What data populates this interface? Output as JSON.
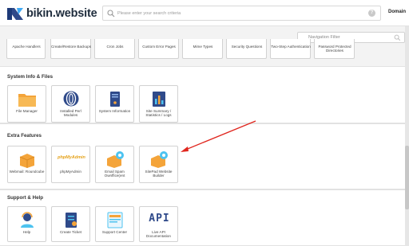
{
  "header": {
    "brand": "bikin.website",
    "search_placeholder": "Please enter your search criteria",
    "help_icon": "?",
    "domain_link": "Domain"
  },
  "nav_filter": {
    "placeholder": "Navigation Filter"
  },
  "strip": {
    "items": [
      "Apache Handlers",
      "Create/Restore Backups",
      "Cron Jobs",
      "Custom Error Pages",
      "Mime Types",
      "Security Questions",
      "Two-Step Authentication",
      "Password Protected Directories"
    ]
  },
  "sections": {
    "system_info": {
      "title": "System Info & Files",
      "tiles": [
        "File Manager",
        "Installed Perl Modules",
        "System Information",
        "Site Summary / Statistics / Logs"
      ]
    },
    "extra_features": {
      "title": "Extra Features",
      "tiles": [
        "Webmail: Roundcube",
        "phpMyAdmin",
        "Email Spam Ownffice(ent",
        "SitePad Website Builder"
      ],
      "phpmyadmin_logo": "phpMyAdmin"
    },
    "support_help": {
      "title": "Support & Help",
      "tiles": [
        "Help",
        "Create Ticket",
        "Support Center",
        "Live API Documentation"
      ],
      "api_logo": "API"
    }
  },
  "colors": {
    "accent_red": "#e0261e",
    "orange": "#f4a43a",
    "navy": "#2f4a8a",
    "brand_dark": "#1f2d3d"
  }
}
